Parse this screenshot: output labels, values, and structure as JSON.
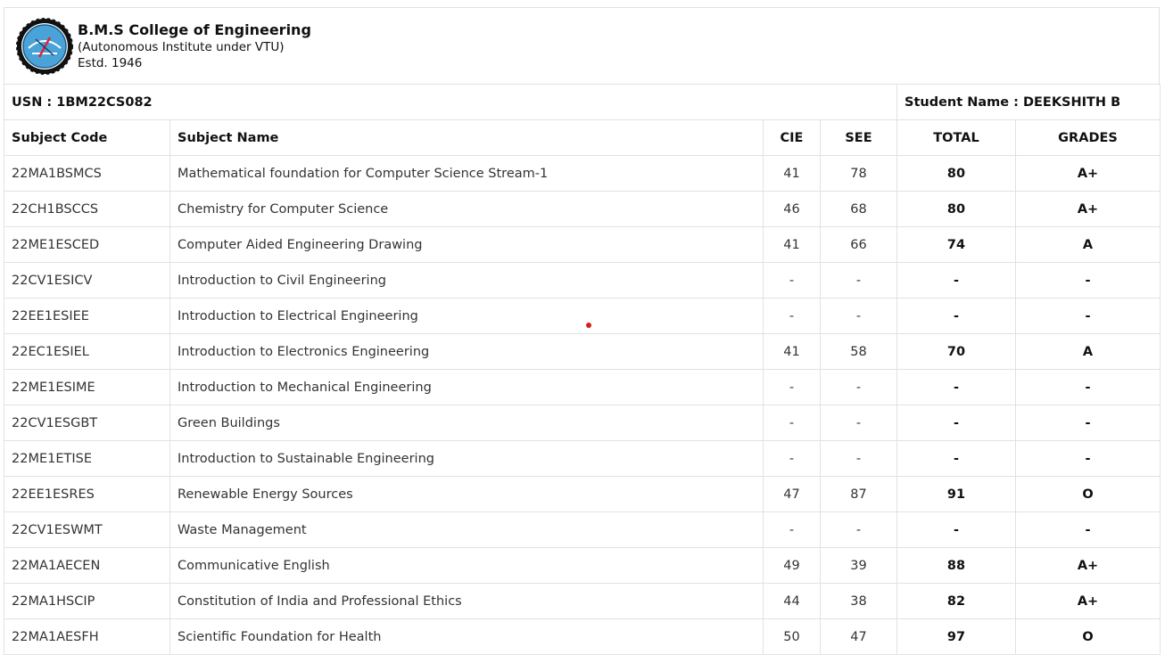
{
  "header": {
    "college_name": "B.M.S College of Engineering",
    "subtitle": "(Autonomous Institute under VTU)",
    "established": "Estd. 1946",
    "logo_icon": "college-seal-icon"
  },
  "student": {
    "usn": "USN : 1BM22CS082",
    "name": "Student Name : DEEKSHITH B"
  },
  "table": {
    "headers": [
      "Subject Code",
      "Subject Name",
      "CIE",
      "SEE",
      "TOTAL",
      "GRADES"
    ],
    "rows": [
      [
        "22MA1BSMCS",
        "Mathematical foundation for Computer Science Stream-1",
        "41",
        "78",
        "80",
        "A+"
      ],
      [
        "22CH1BSCCS",
        "Chemistry for Computer Science",
        "46",
        "68",
        "80",
        "A+"
      ],
      [
        "22ME1ESCED",
        "Computer Aided Engineering Drawing",
        "41",
        "66",
        "74",
        "A"
      ],
      [
        "22CV1ESICV",
        "Introduction to Civil Engineering",
        "-",
        "-",
        "-",
        "-"
      ],
      [
        "22EE1ESIEE",
        "Introduction to Electrical Engineering",
        "-",
        "-",
        "-",
        "-"
      ],
      [
        "22EC1ESIEL",
        "Introduction to Electronics Engineering",
        "41",
        "58",
        "70",
        "A"
      ],
      [
        "22ME1ESIME",
        "Introduction to Mechanical Engineering",
        "-",
        "-",
        "-",
        "-"
      ],
      [
        "22CV1ESGBT",
        "Green Buildings",
        "-",
        "-",
        "-",
        "-"
      ],
      [
        "22ME1ETISE",
        "Introduction to Sustainable Engineering",
        "-",
        "-",
        "-",
        "-"
      ],
      [
        "22EE1ESRES",
        "Renewable Energy Sources",
        "47",
        "87",
        "91",
        "O"
      ],
      [
        "22CV1ESWMT",
        "Waste Management",
        "-",
        "-",
        "-",
        "-"
      ],
      [
        "22MA1AECEN",
        "Communicative English",
        "49",
        "39",
        "88",
        "A+"
      ],
      [
        "22MA1HSCIP",
        "Constitution of India and Professional Ethics",
        "44",
        "38",
        "82",
        "A+"
      ],
      [
        "22MA1AESFH",
        "Scientific Foundation for Health",
        "50",
        "47",
        "97",
        "O"
      ]
    ]
  },
  "colors": {
    "border": "#dee2e6",
    "cursor_dot": "#e0191a"
  }
}
